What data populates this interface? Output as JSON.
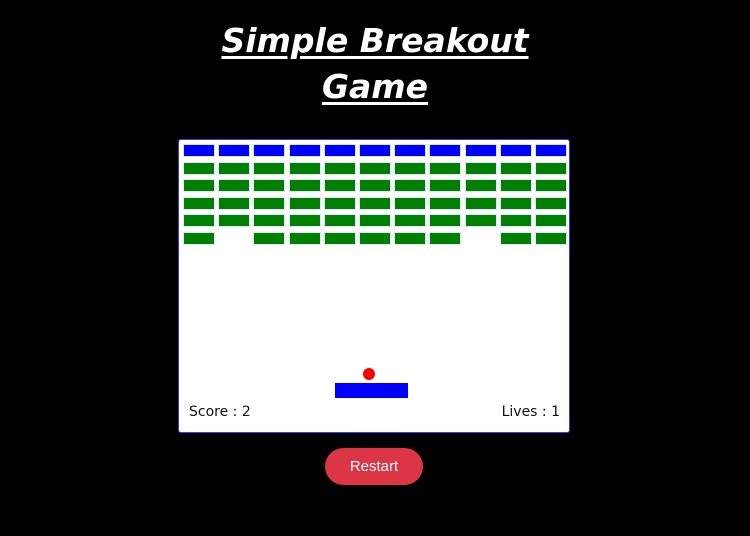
{
  "title": {
    "line1": "Simple Breakout",
    "line2": "Game"
  },
  "game": {
    "columns": 11,
    "rows": 6,
    "row_colors": [
      "#0000ff",
      "#008000",
      "#008000",
      "#008000",
      "#008000",
      "#008000"
    ],
    "missing_bricks": [
      [
        5,
        1
      ],
      [
        5,
        8
      ]
    ],
    "paddle_color": "#0000ff",
    "ball_color": "#ff0000",
    "board_background": "#ffffff",
    "board_border_color": "#3a3aff"
  },
  "hud": {
    "score_label": "Score : 2",
    "lives_label": "Lives : 1",
    "score": 2,
    "lives": 1
  },
  "controls": {
    "restart_label": "Restart",
    "restart_color": "#dc3545"
  }
}
